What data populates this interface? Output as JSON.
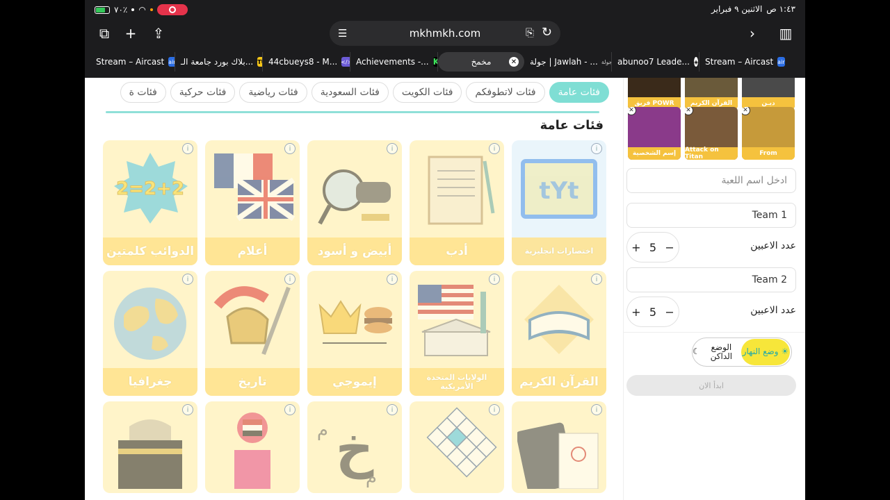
{
  "status": {
    "time": "١:٤٣ ص",
    "date": "الاثنين ٩ فبراير",
    "battery": "٧٠٪"
  },
  "browser": {
    "url": "mkhmkh.com"
  },
  "tabs": [
    {
      "title": "Stream – Aircast",
      "favicon": "air"
    },
    {
      "title": "بلاك بورد جامعة الـ...",
      "favicon": "TU"
    },
    {
      "title": "44cbueys8 - M...",
      "favicon": "</>"
    },
    {
      "title": "Achievements -...",
      "favicon": "K"
    },
    {
      "title": "مخمخ",
      "favicon": ""
    },
    {
      "title": "جولة | Jawlah - ...",
      "favicon": "جولة"
    },
    {
      "title": "abunoo7 Leade...",
      "favicon": "◈"
    },
    {
      "title": "Stream – Aircast",
      "favicon": "air"
    }
  ],
  "categories": [
    "فئات عامة",
    "فئات لاتطوفكم",
    "فئات الكويت",
    "فئات السعودية",
    "فئات رياضية",
    "فئات حركية",
    "فئات ة"
  ],
  "section_title": "فئات عامة",
  "cards": [
    {
      "label": "اختصارات انجليزية",
      "art": "yt",
      "bg": "#e9f4fb"
    },
    {
      "label": "أدب",
      "art": "scroll",
      "bg": "#fff4d6"
    },
    {
      "label": "أبيض و أسود",
      "art": "magnifier",
      "bg": "#fff4d6"
    },
    {
      "label": "أعلام",
      "art": "flags",
      "bg": "#fff4d6"
    },
    {
      "label": "الدوائب كلمتين",
      "art": "2+2=2",
      "bg": "#fff4d6"
    },
    {
      "label": "القرآن الكريم",
      "art": "quran",
      "bg": "#fff4d6"
    },
    {
      "label": "الولايات المتحدة الأمريكية",
      "art": "usa",
      "bg": "#fff4d6"
    },
    {
      "label": "إيموجي",
      "art": "emoji",
      "bg": "#fff4d6"
    },
    {
      "label": "تاريخ",
      "art": "helmet",
      "bg": "#fff4d6"
    },
    {
      "label": "جغرافيا",
      "art": "globe",
      "bg": "#fff4d6"
    },
    {
      "label": "",
      "art": "passport",
      "bg": "#fff4d6"
    },
    {
      "label": "",
      "art": "letters-grid",
      "bg": "#fff4d6"
    },
    {
      "label": "",
      "art": "letters",
      "bg": "#fff4d6"
    },
    {
      "label": "",
      "art": "egypt-pin",
      "bg": "#fff4d6"
    },
    {
      "label": "",
      "art": "kaaba",
      "bg": "#fff4d6"
    }
  ],
  "selected_top": [
    "فريق POWR",
    "القرآن الكريم",
    "ديـن"
  ],
  "selected": [
    {
      "caption": "From",
      "color": "#c69a3a"
    },
    {
      "caption": "Attack on Titan",
      "color": "#7a5a3a"
    },
    {
      "caption": "إسم الشخصية",
      "color": "#8a3a8a"
    }
  ],
  "game_name_placeholder": "ادخل اسم اللعبة",
  "team1": "Team 1",
  "team2": "Team 2",
  "players_label": "عدد الاعبين",
  "team1_players": "5",
  "team2_players": "5",
  "mode_day": "وضع النهار",
  "mode_night": "الوضع الداكن",
  "start": "ابدأ الان",
  "colors": {
    "accent": "#7fded4",
    "card_label": "#ffe28c",
    "rec": "#e5334b"
  }
}
